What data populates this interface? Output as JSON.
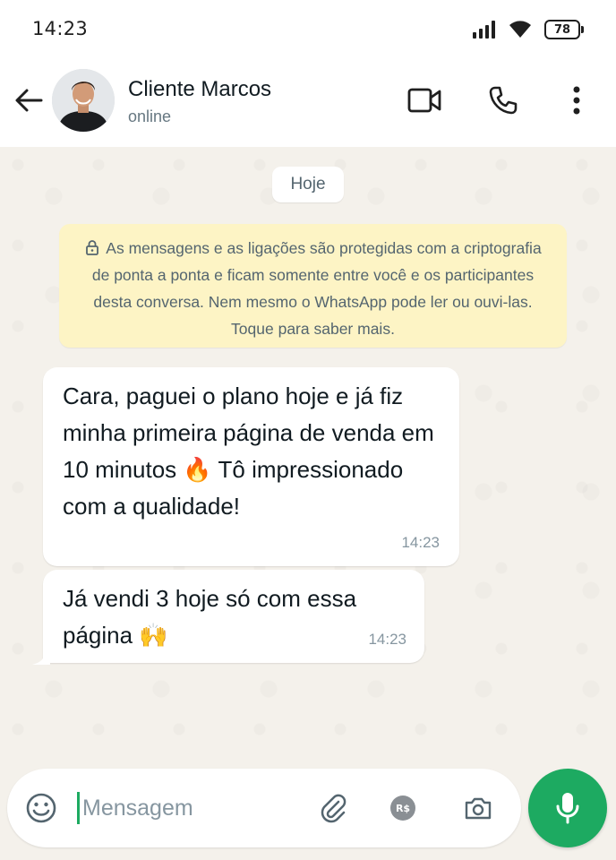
{
  "status_bar": {
    "time": "14:23",
    "battery": "78"
  },
  "header": {
    "contact_name": "Cliente Marcos",
    "contact_status": "online"
  },
  "chat": {
    "date_chip": "Hoje",
    "encryption_notice": "As mensagens e as ligações são protegidas com a criptografia de ponta a ponta e ficam somente entre você e os participantes desta conversa. Nem mesmo o WhatsApp pode ler ou ouvi-las. Toque para saber mais.",
    "messages": [
      {
        "text": "Cara, paguei o plano hoje e já fiz minha primeira página de venda em 10 minutos 🔥 Tô impressionado com a qualidade!",
        "time": "14:23"
      },
      {
        "text": "Já vendi 3 hoje só com essa página 🙌",
        "time": "14:23"
      }
    ]
  },
  "composer": {
    "placeholder": "Mensagem",
    "currency_badge": "R$"
  },
  "colors": {
    "accent_green": "#1daa61",
    "notice_yellow": "#fdf4c5",
    "chat_bg": "#f4f1eb"
  },
  "icons": [
    "back-arrow-icon",
    "video-call-icon",
    "phone-icon",
    "more-options-icon",
    "lock-icon",
    "emoji-icon",
    "attach-icon",
    "payment-icon",
    "camera-icon",
    "mic-icon",
    "signal-icon",
    "wifi-icon",
    "battery-icon"
  ]
}
